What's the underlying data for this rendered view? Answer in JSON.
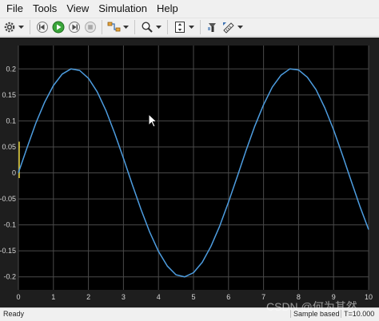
{
  "menu": {
    "items": [
      {
        "label": "File",
        "name": "menu-file"
      },
      {
        "label": "Tools",
        "name": "menu-tools"
      },
      {
        "label": "View",
        "name": "menu-view"
      },
      {
        "label": "Simulation",
        "name": "menu-simulation"
      },
      {
        "label": "Help",
        "name": "menu-help"
      }
    ]
  },
  "toolbar": {
    "icons": [
      "settings-gear-icon",
      "step-back-icon",
      "run-icon",
      "step-forward-icon",
      "stop-icon",
      "highlight-signal-icon",
      "zoom-icon",
      "autoscale-icon",
      "style-icon",
      "measurements-icon"
    ]
  },
  "chart_data": {
    "type": "line",
    "title": "",
    "xlabel": "",
    "ylabel": "",
    "xlim": [
      0,
      10
    ],
    "ylim": [
      -0.225,
      0.245
    ],
    "xticks": [
      0,
      1,
      2,
      3,
      4,
      5,
      6,
      7,
      8,
      9,
      10
    ],
    "yticks": [
      -0.2,
      -0.15,
      -0.1,
      -0.05,
      0,
      0.05,
      0.1,
      0.15,
      0.2
    ],
    "ytick_labels": [
      "-0.2",
      "-0.15",
      "-0.1",
      "-0.05",
      "0",
      "0.05",
      "0.1",
      "0.15",
      "0.2"
    ],
    "grid": true,
    "colors": {
      "background": "#000000",
      "grid": "#4a4a4a",
      "series": "#4d9de0",
      "input_marker": "#e8d43a",
      "tick_label": "#d8d8d8"
    },
    "series": [
      {
        "x": [
          0,
          0.25,
          0.5,
          0.75,
          1,
          1.25,
          1.5,
          1.75,
          2,
          2.25,
          2.5,
          2.75,
          3,
          3.25,
          3.5,
          3.75,
          4,
          4.25,
          4.5,
          4.75,
          5,
          5.25,
          5.5,
          5.75,
          6,
          6.25,
          6.5,
          6.75,
          7,
          7.25,
          7.5,
          7.75,
          8,
          8.25,
          8.5,
          8.75,
          9,
          9.25,
          9.5,
          9.75,
          10
        ],
        "values": [
          0,
          0.049,
          0.096,
          0.136,
          0.168,
          0.19,
          0.2,
          0.197,
          0.182,
          0.156,
          0.12,
          0.076,
          0.028,
          -0.022,
          -0.07,
          -0.114,
          -0.151,
          -0.179,
          -0.196,
          -0.2,
          -0.192,
          -0.172,
          -0.141,
          -0.102,
          -0.056,
          -0.007,
          0.043,
          0.09,
          0.131,
          0.165,
          0.188,
          0.2,
          0.198,
          0.184,
          0.16,
          0.125,
          0.083,
          0.035,
          -0.015,
          -0.064,
          -0.109
        ]
      }
    ]
  },
  "status": {
    "ready": "Ready",
    "sample": "Sample based",
    "time": "T=10.000"
  },
  "watermark": "CSDN @何为其然"
}
